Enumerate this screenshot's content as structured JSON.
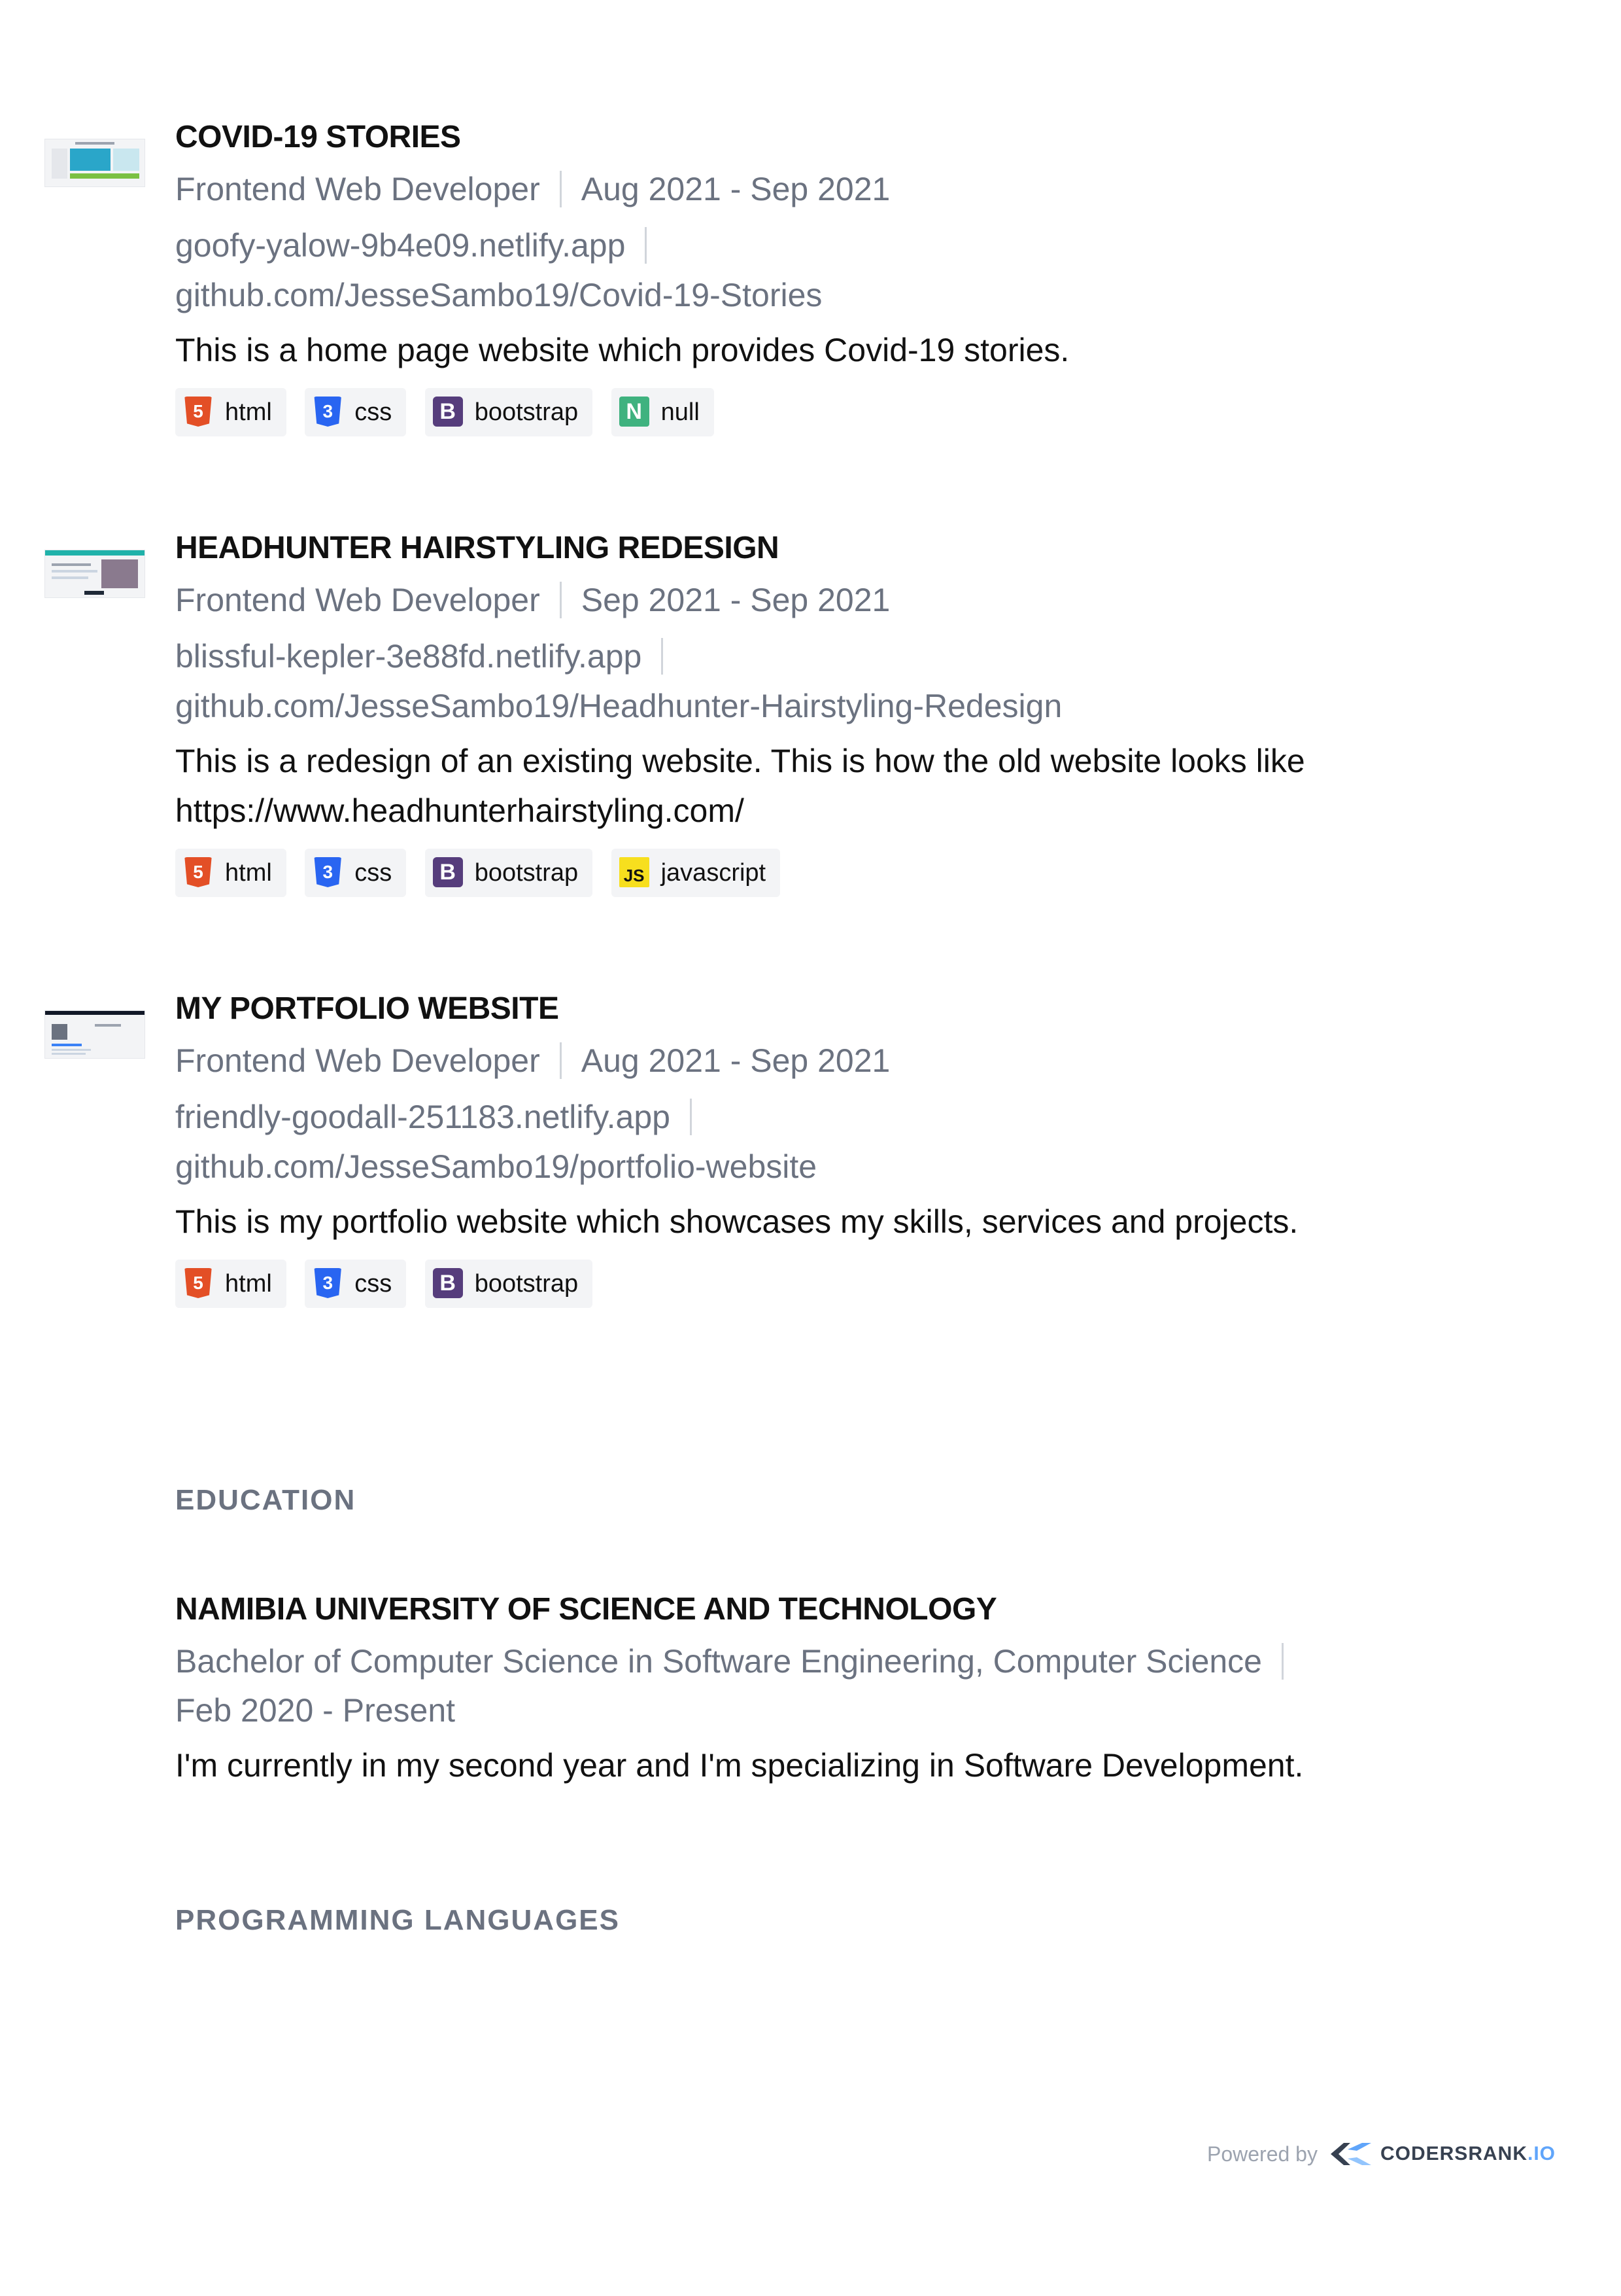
{
  "projects": [
    {
      "title": "COVID-19 STORIES",
      "role": "Frontend Web Developer",
      "dates": "Aug 2021 - Sep 2021",
      "link1": "goofy-yalow-9b4e09.netlify.app",
      "link2": "github.com/JesseSambo19/Covid-19-Stories",
      "description": "This is a home page website which provides Covid-19 stories.",
      "tags": [
        {
          "icon": "html5-icon",
          "glyph": "5",
          "label": "html"
        },
        {
          "icon": "css3-icon",
          "glyph": "3",
          "label": "css"
        },
        {
          "icon": "bootstrap-icon",
          "glyph": "B",
          "label": "bootstrap"
        },
        {
          "icon": "node-icon",
          "glyph": "N",
          "label": "null"
        }
      ]
    },
    {
      "title": "HEADHUNTER HAIRSTYLING REDESIGN",
      "role": "Frontend Web Developer",
      "dates": "Sep 2021 - Sep 2021",
      "link1": "blissful-kepler-3e88fd.netlify.app",
      "link2": "github.com/JesseSambo19/Headhunter-Hairstyling-Redesign",
      "description": "This is a redesign of an existing website. This is how the old website looks like https://www.headhunterhairstyling.com/",
      "tags": [
        {
          "icon": "html5-icon",
          "glyph": "5",
          "label": "html"
        },
        {
          "icon": "css3-icon",
          "glyph": "3",
          "label": "css"
        },
        {
          "icon": "bootstrap-icon",
          "glyph": "B",
          "label": "bootstrap"
        },
        {
          "icon": "javascript-icon",
          "glyph": "JS",
          "label": "javascript"
        }
      ]
    },
    {
      "title": "MY PORTFOLIO WEBSITE",
      "role": "Frontend Web Developer",
      "dates": "Aug 2021 - Sep 2021",
      "link1": "friendly-goodall-251183.netlify.app",
      "link2": "github.com/JesseSambo19/portfolio-website",
      "description": "This is my portfolio website which showcases my skills, services and projects.",
      "tags": [
        {
          "icon": "html5-icon",
          "glyph": "5",
          "label": "html"
        },
        {
          "icon": "css3-icon",
          "glyph": "3",
          "label": "css"
        },
        {
          "icon": "bootstrap-icon",
          "glyph": "B",
          "label": "bootstrap"
        }
      ]
    }
  ],
  "education": {
    "heading": "EDUCATION",
    "school": "NAMIBIA UNIVERSITY OF SCIENCE AND TECHNOLOGY",
    "degree": "Bachelor of Computer Science in Software Engineering, Computer Science",
    "dates": "Feb 2020 - Present",
    "description": "I'm currently in my second year and I'm specializing in Software Development."
  },
  "languages": {
    "heading": "PROGRAMMING LANGUAGES"
  },
  "footer": {
    "powered_by": "Powered by",
    "brand": "CODERSRANK",
    "brand_suffix": ".IO"
  },
  "colors": {
    "muted": "#6b7280",
    "separator": "#d1d5db",
    "tag_bg": "#f3f4f6"
  }
}
